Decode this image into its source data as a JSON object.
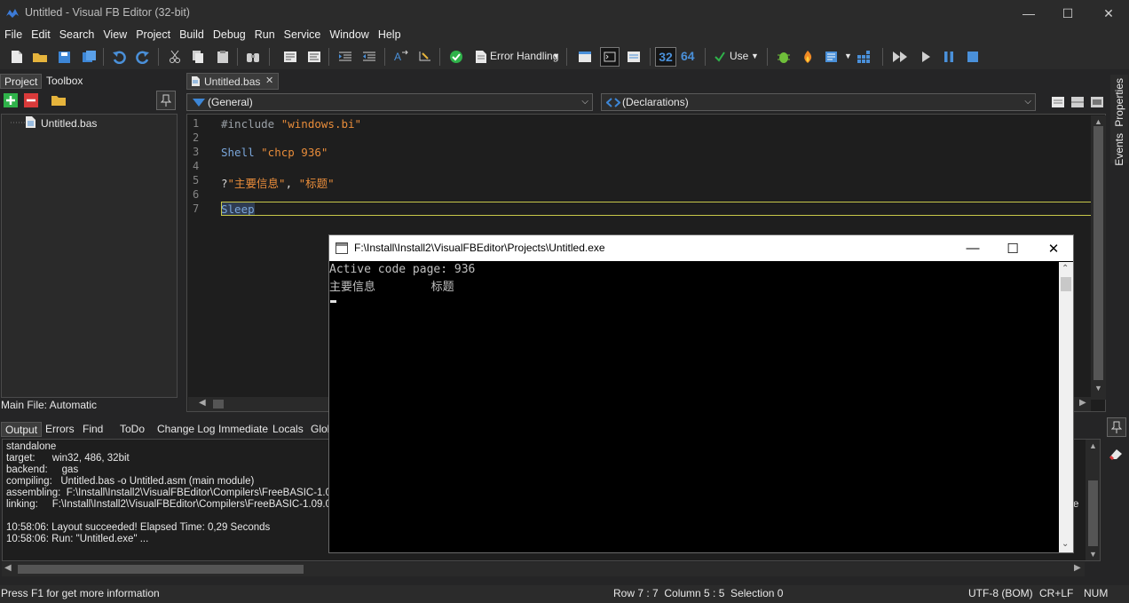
{
  "window": {
    "title": "Untitled - Visual FB Editor (32-bit)",
    "minimize": "—",
    "maximize": "☐",
    "close": "✕"
  },
  "menu": [
    "File",
    "Edit",
    "Search",
    "View",
    "Project",
    "Build",
    "Debug",
    "Run",
    "Service",
    "Window",
    "Help"
  ],
  "toolbar": {
    "error_handling": "Error Handling",
    "bits32": "32",
    "bits64": "64",
    "use": "Use"
  },
  "left_panel": {
    "tabs": [
      "Project",
      "Toolbox"
    ],
    "tree_item": "Untitled.bas",
    "main_file": "Main File: Automatic"
  },
  "editor": {
    "tab": "Untitled.bas",
    "combo_general": "(General)",
    "combo_declarations": "(Declarations)",
    "lines": [
      {
        "n": "1",
        "tokens": [
          {
            "t": "#include ",
            "c": "#9aa0a6"
          },
          {
            "t": "\"windows.bi\"",
            "c": "#e88c3a"
          }
        ]
      },
      {
        "n": "2",
        "tokens": []
      },
      {
        "n": "3",
        "tokens": [
          {
            "t": "Shell ",
            "c": "#7aa6da"
          },
          {
            "t": "\"chcp 936\"",
            "c": "#e88c3a"
          }
        ]
      },
      {
        "n": "4",
        "tokens": []
      },
      {
        "n": "5",
        "tokens": [
          {
            "t": "?",
            "c": "#d4d4d4"
          },
          {
            "t": "\"主要信息\"",
            "c": "#e88c3a"
          },
          {
            "t": ", ",
            "c": "#d4d4d4"
          },
          {
            "t": "\"标题\"",
            "c": "#e88c3a"
          }
        ]
      },
      {
        "n": "6",
        "tokens": []
      },
      {
        "n": "7",
        "tokens": [
          {
            "t": "Sleep",
            "c": "#7aa6da"
          }
        ]
      }
    ]
  },
  "right_strip": [
    "Properties",
    "Events"
  ],
  "output": {
    "tabs": [
      "Output",
      "Errors",
      "Find",
      "ToDo",
      "Change Log",
      "Immediate",
      "Locals",
      "Glob"
    ],
    "lines": [
      "standalone",
      "target:      win32, 486, 32bit",
      "backend:     gas",
      "compiling:   Untitled.bas -o Untitled.asm (main module)",
      "assembling:  F:\\Install\\Install2\\VisualFBEditor\\Compilers\\FreeBASIC-1.09.0-",
      "linking:     F:\\Install\\Install2\\VisualFBEditor\\Compilers\\FreeBASIC-1.09.0-wir",
      "",
      "10:58:06: Layout succeeded! Elapsed Time: 0,29 Seconds",
      "10:58:06: Run: \"Untitled.exe\" ..."
    ],
    "tail_fragment": "e"
  },
  "status": {
    "hint": "Press F1 for get more information",
    "position": "Row 7 : 7  Column 5 : 5  Selection 0",
    "encoding": "UTF-8 (BOM)",
    "eol": "CR+LF",
    "num": "NUM"
  },
  "console": {
    "title": "F:\\Install\\Install2\\VisualFBEditor\\Projects\\Untitled.exe",
    "lines": [
      "Active code page: 936",
      "主要信息        标题"
    ]
  },
  "colors": {
    "accent_green": "#2fb24a",
    "accent_blue": "#4a90d9",
    "editor_bg": "#1e1e1e"
  }
}
